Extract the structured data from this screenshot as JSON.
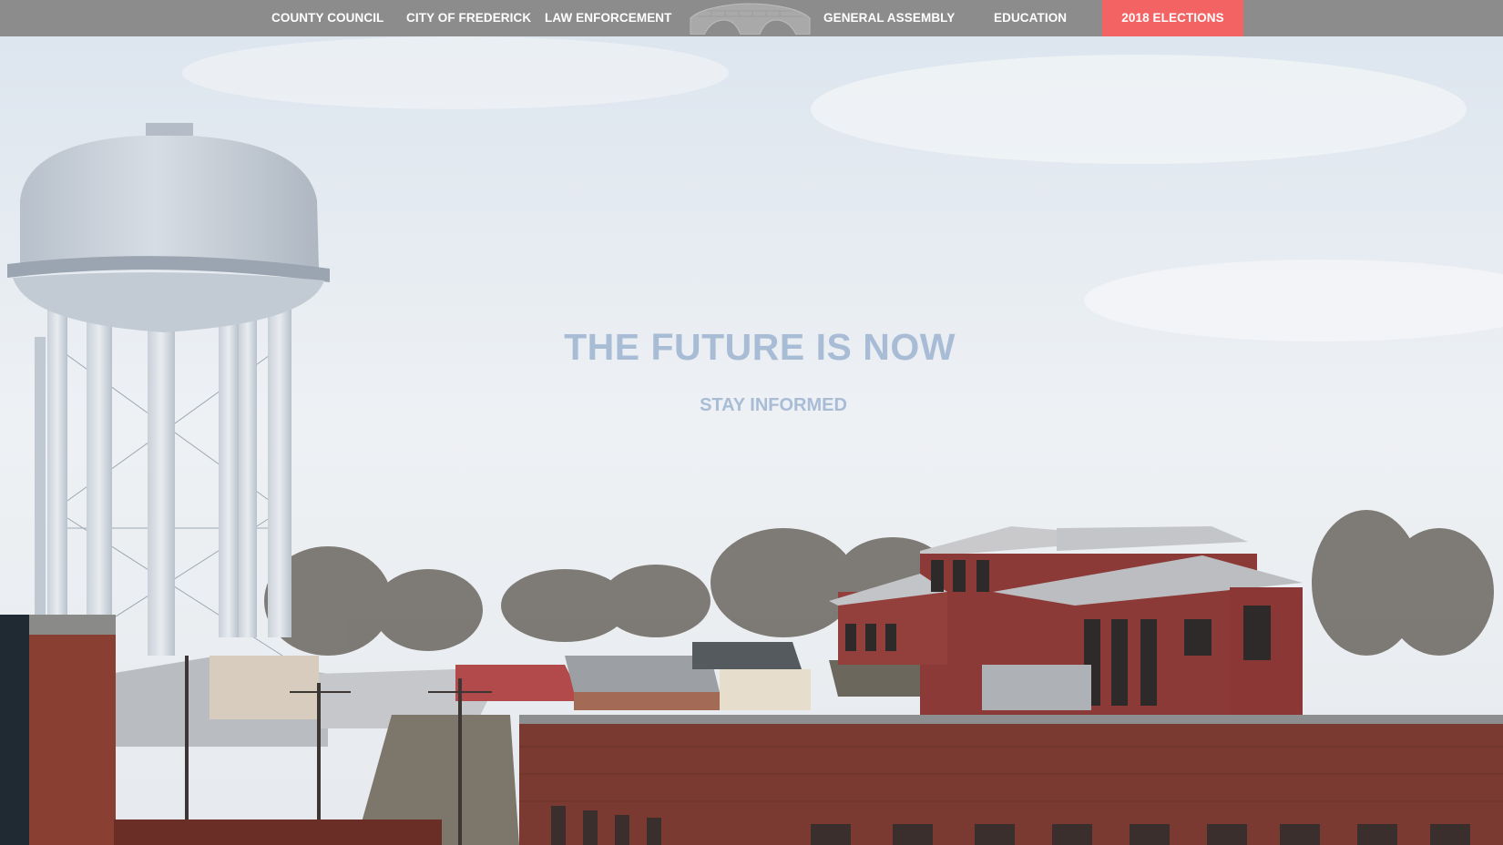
{
  "nav": {
    "left_items": [
      "COUNTY COUNCIL",
      "CITY OF FREDERICK",
      "LAW ENFORCEMENT"
    ],
    "right_items": [
      "GENERAL ASSEMBLY",
      "EDUCATION"
    ],
    "cta_label": "2018 ELECTIONS",
    "logo_icon": "bridge-arch-logo-icon",
    "colors": {
      "bar": "#8c8c8c",
      "cta": "#f46363",
      "text": "#ffffff"
    }
  },
  "hero": {
    "headline": "THE FUTURE IS NOW",
    "subheadline": "STAY INFORMED",
    "headline_color": "#a9bcd6"
  }
}
